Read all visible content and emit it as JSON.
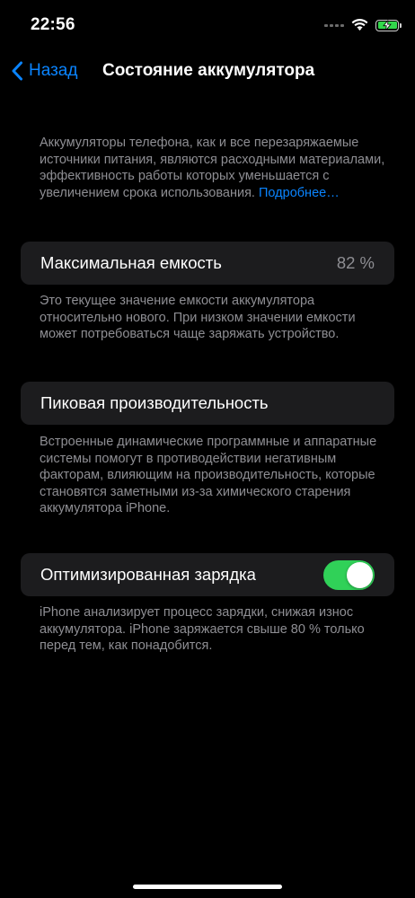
{
  "status_bar": {
    "time": "22:56",
    "icons": [
      "cellular-signal-icon",
      "wifi-icon",
      "battery-charging-icon"
    ],
    "battery_color": "#32d74b"
  },
  "nav": {
    "back_label": "Назад",
    "title": "Состояние аккумулятора",
    "accent_color": "#0a84ff"
  },
  "intro": {
    "text": "Аккумуляторы телефона, как и все перезаряжаемые источники питания, являются расходными материалами, эффективность работы которых уменьшается с увеличением срока использования. ",
    "link": "Подробнее…"
  },
  "max_capacity": {
    "label": "Максимальная емкость",
    "value": "82 %",
    "footer": "Это текущее значение емкости аккумулятора относительно нового. При низком значении емкости может потребоваться чаще заряжать устройство."
  },
  "peak_performance": {
    "label": "Пиковая производительность",
    "footer": "Встроенные динамические программные и аппаратные системы помогут в противодействии негативным факторам, влияющим на производительность, которые становятся заметными из-за химического старения аккумулятора iPhone."
  },
  "optimized_charging": {
    "label": "Оптимизированная зарядка",
    "enabled": true,
    "toggle_color": "#30d158",
    "footer": "iPhone анализирует процесс зарядки, снижая износ аккумулятора. iPhone заряжается свыше 80 % только перед тем, как понадобится."
  }
}
